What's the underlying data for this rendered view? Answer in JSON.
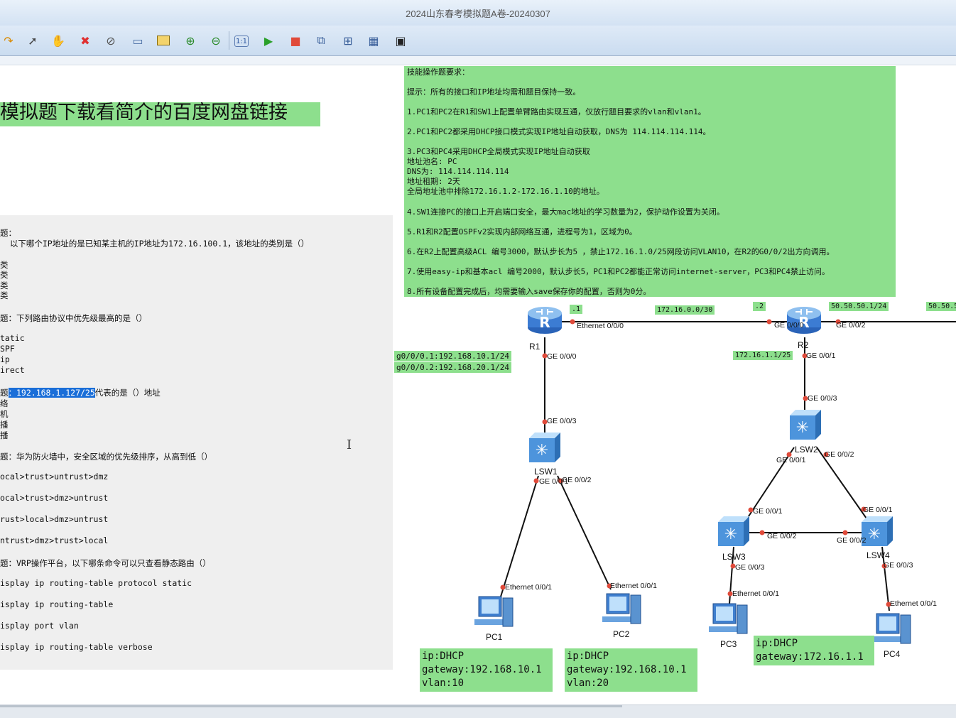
{
  "window": {
    "title": "2024山东春考模拟题A卷-20240307"
  },
  "toolbar": {
    "icons": [
      "redo-icon",
      "pointer-icon",
      "hand-icon",
      "delete-icon",
      "delete-link-icon",
      "text-note-icon",
      "rectangle-icon",
      "zoom-in-icon",
      "zoom-out-icon",
      "fit-icon",
      "start-icon",
      "stop-icon",
      "capture-icon",
      "topology-icon",
      "grid-icon",
      "console-icon"
    ]
  },
  "banner": {
    "text": "模拟题下载看简介的百度网盘链接"
  },
  "quiz": {
    "lines": [
      "题：",
      "  以下哪个IP地址的是已知某主机的IP地址为172.16.100.1，该地址的类别是（）",
      "类",
      "类",
      "类",
      "类",
      "题：下列路由协议中优先级最高的是（）",
      "tatic",
      "SPF",
      "ip",
      "irect",
      "代表的是（）地址",
      "络",
      "机",
      "播",
      "播",
      "题：华为防火墙中，安全区域的优先级排序，从高到低（）",
      "ocal>trust>untrust>dmz",
      "ocal>trust>dmz>untrust",
      "rust>local>dmz>untrust",
      "ntrust>dmz>trust>local",
      "题：VRP操作平台，以下哪条命令可以只查看静态路由（）",
      "isplay ip routing-table protocol static",
      "isplay ip routing-table",
      "isplay port vlan",
      "isplay ip routing-table verbose"
    ],
    "q3_prefix": "题",
    "q3_selected": "：192.168.1.127/25"
  },
  "requirements": {
    "lines": [
      "技能操作题要求：",
      "提示：所有的接口和IP地址均需和题目保持一致。",
      "1.PC1和PC2在R1和SW1上配置单臂路由实现互通，仅放行题目要求的vlan和vlan1。",
      "2.PC1和PC2都采用DHCP接口模式实现IP地址自动获取，DNS为 114.114.114.114。",
      "3.PC3和PC4采用DHCP全局模式实现IP地址自动获取",
      "地址池名: PC",
      "DNS为: 114.114.114.114",
      "地址租期: 2天",
      "全局地址池中排除172.16.1.2-172.16.1.10的地址。",
      "4.SW1连接PC的接口上开启端口安全，最大mac地址的学习数量为2，保护动作设置为关闭。",
      "5.R1和R2配置OSPFv2实现内部网络互通，进程号为1，区域为0。",
      "6.在R2上配置高级ACL 编号3000，默认步长为5 ，禁止172.16.1.0/25网段访问VLAN10，在R2的G0/0/2出方向调用。",
      "7.使用easy-ip和基本acl 编号2000，默认步长5，PC1和PC2都能正常访问internet-server，PC3和PC4禁止访问。",
      "8.所有设备配置完成后，均需要输入save保存你的配置，否则为0分。"
    ]
  },
  "topology": {
    "devices": {
      "r1": "R1",
      "r2": "R2",
      "lsw1": "LSW1",
      "lsw2": "LSW2",
      "lsw3": "LSW3",
      "lsw4": "LSW4",
      "pc1": "PC1",
      "pc2": "PC2",
      "pc3": "PC3",
      "pc4": "PC4"
    },
    "ports": {
      "r1_e000": "Ethernet 0/0/0",
      "r1_ge000": "GE 0/0/0",
      "r2_ge000": "GE 0/0/0",
      "r2_ge002": "GE 0/0/2",
      "r2_ge001": "GE 0/0/1",
      "lsw1_ge003": "GE 0/0/3",
      "lsw1_ge001": "GE 0/0/1",
      "lsw1_ge002": "GE 0/0/2",
      "lsw2_ge003": "GE 0/0/3",
      "lsw2_ge001": "GE 0/0/1",
      "lsw2_ge002": "GE 0/0/2",
      "lsw3_ge001": "GE 0/0/1",
      "lsw3_ge002": "GE 0/0/2",
      "lsw3_ge003": "GE 0/0/3",
      "lsw4_ge001": "GE 0/0/1",
      "lsw4_ge002": "GE 0/0/2",
      "lsw4_ge003": "GE 0/0/3",
      "pc1_e001": "Ethernet 0/0/1",
      "pc2_e001": "Ethernet 0/0/1",
      "pc3_e001": "Ethernet 0/0/1",
      "pc4_e001": "Ethernet 0/0/1"
    },
    "labels": {
      "r1_addr": ".1",
      "link_net": "172.16.0.0/30",
      "r2_addr": ".2",
      "r2_wan": "50.50.50.1/24",
      "wan_cut": "50.50.5",
      "r1_sub1": "g0/0/0.1:192.168.10.1/24",
      "r1_sub2": "g0/0/0.2:192.168.20.1/24",
      "r2_lan": "172.16.1.1/25"
    },
    "info_boxes": {
      "pc1": [
        "ip:DHCP",
        "gateway:192.168.10.1",
        "vlan:10"
      ],
      "pc2": [
        "ip:DHCP",
        "gateway:192.168.10.1",
        "vlan:20"
      ],
      "pc34": [
        "ip:DHCP",
        "gateway:172.16.1.1"
      ]
    },
    "colors": {
      "link": "#111111",
      "port_dot": "#e04a3a",
      "label_bg": "#8ddf8d"
    }
  }
}
